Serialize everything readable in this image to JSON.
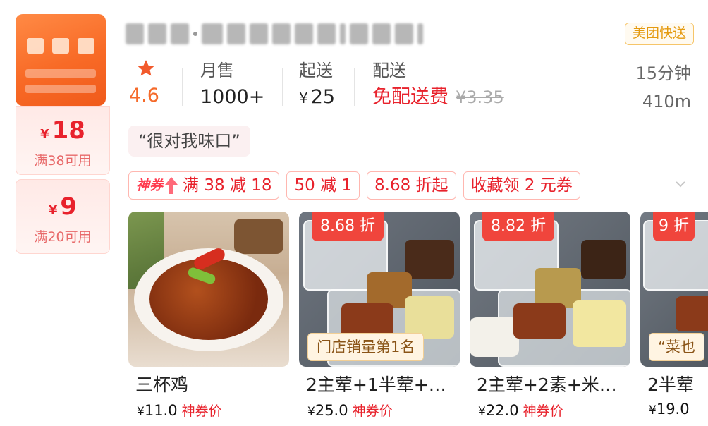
{
  "shop": {
    "badge": "美团快送"
  },
  "coupons": [
    {
      "currency": "¥",
      "amount": "18",
      "condition": "满38可用"
    },
    {
      "currency": "¥",
      "amount": "9",
      "condition": "满20可用"
    }
  ],
  "stats": {
    "rating": "4.6",
    "monthly_sales_label": "月售",
    "monthly_sales_value": "1000+",
    "min_order_label": "起送",
    "min_order_currency": "¥",
    "min_order_value": "25",
    "delivery_label": "配送",
    "delivery_value": "免配送费",
    "delivery_original": "¥3.35",
    "time": "15分钟",
    "distance": "410m"
  },
  "review": "“很对我味口”",
  "promos": {
    "god_coupon_tag": "神券",
    "items": [
      "满 38 减 18",
      "50 减 1",
      "8.68 折起",
      "收藏领 2 元券"
    ]
  },
  "products": [
    {
      "name": "三杯鸡",
      "currency": "¥",
      "price": "11.0",
      "price_tag": "神券价",
      "discount": "",
      "ribbon": ""
    },
    {
      "name": "2主荤+1半荤+…",
      "currency": "¥",
      "price": "25.0",
      "price_tag": "神券价",
      "discount": "8.68 折",
      "ribbon": "门店销量第1名"
    },
    {
      "name": "2主荤+2素+米…",
      "currency": "¥",
      "price": "22.0",
      "price_tag": "神券价",
      "discount": "8.82 折",
      "ribbon": ""
    },
    {
      "name": "2半荤",
      "currency": "¥",
      "price": "19.0",
      "price_tag": "",
      "discount": "9 折",
      "ribbon": "“菜也"
    }
  ],
  "colors": {
    "accent_red": "#e8222c",
    "rating_orange": "#f56a2a",
    "badge_gold": "#e59a0f"
  }
}
